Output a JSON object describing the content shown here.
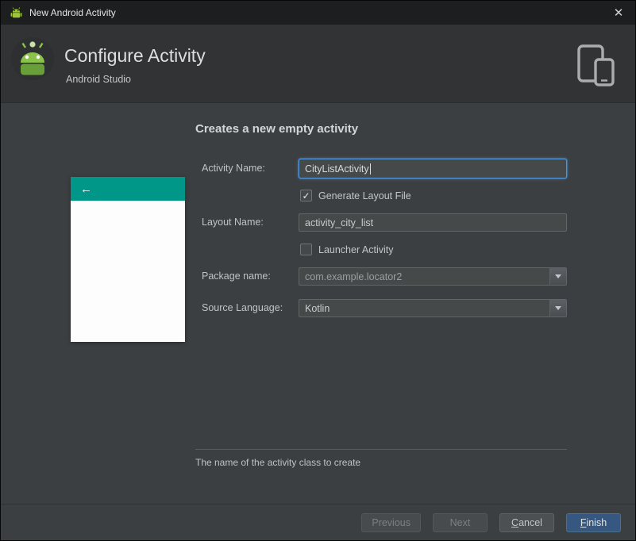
{
  "window": {
    "title": "New Android Activity",
    "close_glyph": "✕"
  },
  "header": {
    "title": "Configure Activity",
    "subtitle": "Android Studio"
  },
  "main": {
    "heading": "Creates a new empty activity",
    "preview": {
      "back_glyph": "←",
      "appbar_color": "#009688"
    },
    "fields": {
      "activity_name": {
        "label": "Activity Name:",
        "value": "CityListActivity"
      },
      "generate_layout": {
        "label": "Generate Layout File",
        "checked": true,
        "check_glyph": "✓"
      },
      "layout_name": {
        "label": "Layout Name:",
        "value": "activity_city_list"
      },
      "launcher_activity": {
        "label": "Launcher Activity",
        "checked": false,
        "check_glyph": ""
      },
      "package_name": {
        "label": "Package name:",
        "value": "com.example.locator2"
      },
      "source_language": {
        "label": "Source Language:",
        "value": "Kotlin"
      }
    },
    "hint": "The name of the activity class to create"
  },
  "buttons": {
    "previous": "Previous",
    "next": "Next",
    "cancel_mnemonic": "C",
    "cancel_rest": "ancel",
    "finish_mnemonic": "F",
    "finish_rest": "inish"
  },
  "colors": {
    "accent_teal": "#009688",
    "focus_blue": "#5394d6",
    "finish_bg": "#365880"
  }
}
